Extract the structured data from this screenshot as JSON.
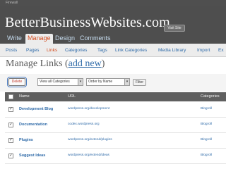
{
  "window": {
    "title": "Firewall"
  },
  "header": {
    "site_title": "BetterBusinessWebsites.com",
    "visit_site": "Visit Site"
  },
  "main_nav": [
    "Write",
    "Manage",
    "Design",
    "Comments"
  ],
  "sub_nav": [
    "Posts",
    "Pages",
    "Links",
    "Categories",
    "Tags",
    "Link Categories",
    "Media Library",
    "Import",
    "Ex"
  ],
  "page": {
    "title": "Manage Links",
    "add_new": "add new"
  },
  "toolbar": {
    "delete_label": "Delete",
    "category_select": "View all Categories",
    "order_select": "Order by Name",
    "filter_label": "Filter"
  },
  "table": {
    "columns": [
      "Name",
      "URL",
      "Categories"
    ],
    "rows": [
      {
        "name": "Development Blog",
        "url": "wordpress.org/development",
        "category": "Blogroll"
      },
      {
        "name": "Documentation",
        "url": "codex.wordpress.org",
        "category": "Blogroll"
      },
      {
        "name": "Plugins",
        "url": "wordpress.org/extend/plugins",
        "category": "Blogroll"
      },
      {
        "name": "Suggest Ideas",
        "url": "wordpress.org/extend/ideas",
        "category": "Blogroll"
      }
    ]
  }
}
